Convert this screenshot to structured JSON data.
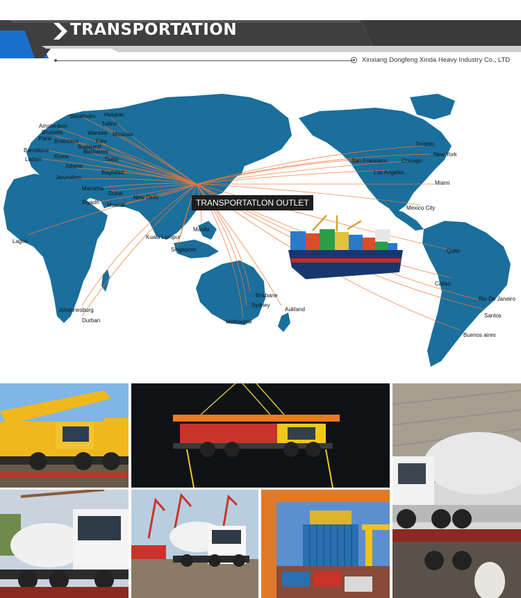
{
  "header": {
    "title": "TRANSPORTATION",
    "company": "Xinxiang Dongfeng Xinda Heavy Industry Co., LTD"
  },
  "map": {
    "outlet_label": "TRANSPORTATLON OUTLET",
    "cities": [
      "Stockholm",
      "Helsinki",
      "Tallinn",
      "Amsterdam",
      "Brussels",
      "Warsaw",
      "Moscow",
      "Paris",
      "Bratislava",
      "Kiev",
      "Budapest",
      "Barcelona",
      "Bucharest",
      "Rome",
      "Lisbon",
      "Tbilisi",
      "Athens",
      "Baghdad",
      "Jerusalem",
      "Manama",
      "Dubai",
      "Riyadh",
      "Muscat",
      "New Delhi",
      "Kuala Lumpur",
      "Singapore",
      "Manila",
      "Lagos",
      "Johannesburg",
      "Durban",
      "Brisbane",
      "Sydney",
      "Aukland",
      "Melbourne",
      "Toronto",
      "New York",
      "San Francisco",
      "Chicago",
      "Los Angeles",
      "Miami",
      "Mexico City",
      "Quito",
      "Callao",
      "Rio De Janeiro",
      "Santos",
      "Buenos aires"
    ]
  },
  "photos": [
    "crane-truck-on-trailer",
    "crane-truck-lifted-at-night",
    "mixer-truck-by-warehouse",
    "mixer-truck-white",
    "mixer-truck-at-port",
    "container-loading-at-port"
  ],
  "colors": {
    "banner_dark": "#3f3f3f",
    "banner_blue": "#1a6fcf",
    "banner_grey": "#cfcfcf",
    "map_land": "#1a6f9c",
    "route": "#f07a3a"
  }
}
